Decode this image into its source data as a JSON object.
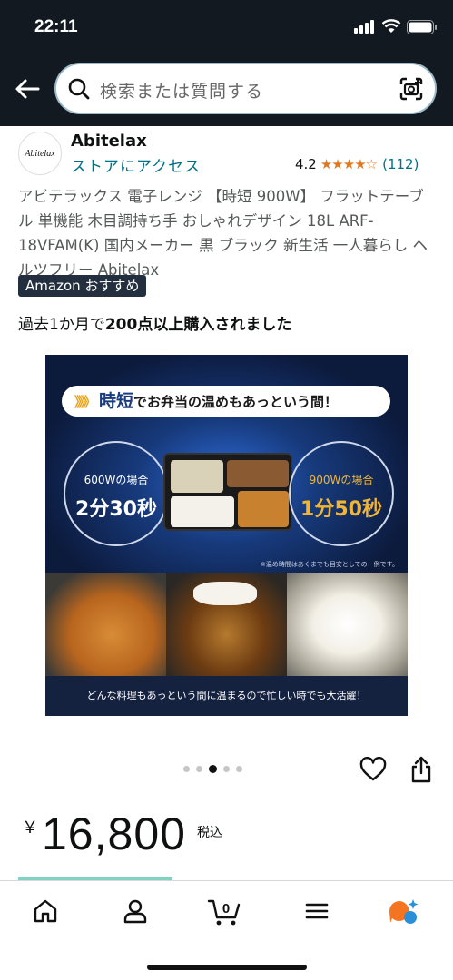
{
  "status_bar": {
    "time": "22:11"
  },
  "header": {
    "search_placeholder": "検索または質問する",
    "colors": {
      "bar": "#131921"
    }
  },
  "product": {
    "brand_logo_text": "Abitelax",
    "brand_name": "Abitelax",
    "store_link": "ストアにアクセス",
    "rating_value": "4.2",
    "rating_stars": "★★★★☆",
    "rating_count": "(112)",
    "title": "アビテラックス 電子レンジ 【時短 900W】 フラットテーブル 単機能 木目調持ち手 おしゃれデザイン 18L ARF-18VFAM(K) 国内メーカー 黒 ブラック 新生活 一人暮らし ヘルツフリー Abitelax",
    "badge": "Amazon おすすめ",
    "bought_prefix": "過去1か月で",
    "bought_bold": "200点以上購入されました",
    "price_currency": "￥",
    "price_value": "16,800",
    "price_tax": "税込"
  },
  "image": {
    "headline_chev": "》》》",
    "headline_em": "時短",
    "headline_rest": "でお弁当の温めもあっという間！",
    "left_label": "600Wの場合",
    "left_time": "2分30秒",
    "right_label": "900Wの場合",
    "right_time": "1分50秒",
    "note": "※温め時間はあくまでも目安としての一例です。",
    "footer": "どんな料理もあっという間に温まるので忙しい時でも大活躍！"
  },
  "carousel": {
    "count": 5,
    "active": 3
  },
  "bottom_nav": {
    "cart_count": "0",
    "items": [
      "home-icon",
      "account-icon",
      "cart-icon",
      "menu-icon",
      "rufus-ai-icon"
    ]
  }
}
